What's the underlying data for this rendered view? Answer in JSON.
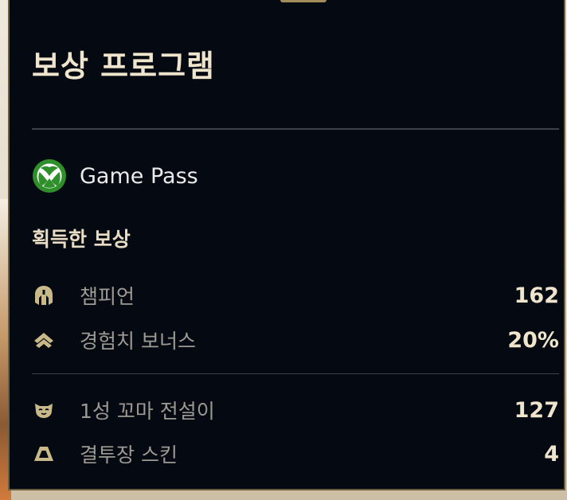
{
  "panel": {
    "title": "보상 프로그램",
    "program": {
      "icon": "xbox-icon",
      "name": "Game Pass",
      "brand_color": "#2f8f2a"
    },
    "section_title": "획득한 보상",
    "rewards": [
      {
        "icon": "champion-helmet-icon",
        "label": "챔피언",
        "value": "162"
      },
      {
        "icon": "xp-chevron-icon",
        "label": "경험치 보너스",
        "value": "20%"
      },
      {
        "icon": "little-legend-icon",
        "label": "1성 꼬마 전설이",
        "value": "127"
      },
      {
        "icon": "arena-skin-icon",
        "label": "결투장 스킨",
        "value": "4"
      }
    ],
    "colors": {
      "background": "#050a12",
      "border": "#6d5e3b",
      "accent_gold": "#c9b989",
      "title_text": "#efe4cc",
      "label_text": "#9d9a93"
    }
  }
}
